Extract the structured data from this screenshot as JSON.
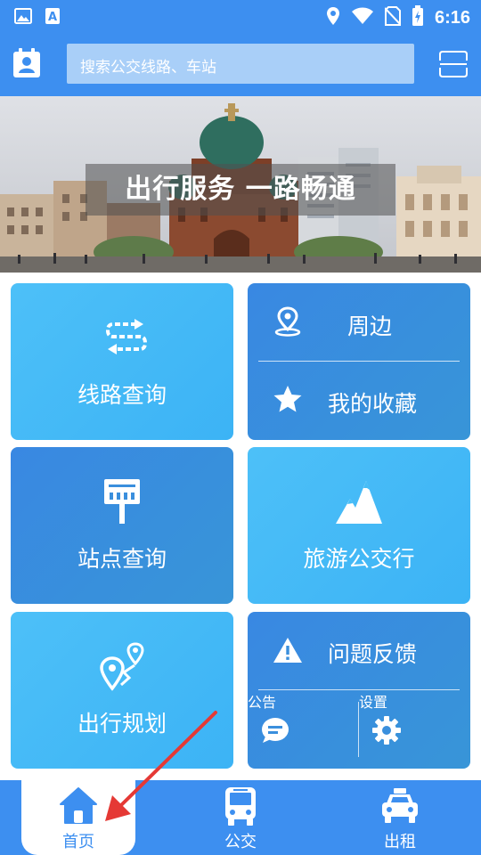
{
  "status_bar": {
    "time": "6:16",
    "icons": [
      "image-icon",
      "text-a-icon",
      "location-icon",
      "wifi-icon",
      "no-sim-icon",
      "battery-charging-icon"
    ]
  },
  "header": {
    "search_placeholder": "搜索公交线路、车站",
    "left_icon": "profile-card-icon",
    "right_icon": "scan-icon"
  },
  "banner": {
    "slogan": "出行服务 一路畅通"
  },
  "tiles": {
    "route_query": {
      "label": "线路查询",
      "icon": "route-arrows-icon"
    },
    "nearby": {
      "label": "周边",
      "icon": "location-pin-icon"
    },
    "favorites": {
      "label": "我的收藏",
      "icon": "star-icon"
    },
    "station_query": {
      "label": "站点查询",
      "icon": "bus-stop-sign-icon"
    },
    "tourism_bus": {
      "label": "旅游公交行",
      "icon": "mountain-icon"
    },
    "trip_planning": {
      "label": "出行规划",
      "icon": "map-route-icon"
    },
    "feedback": {
      "label": "问题反馈",
      "icon": "warning-icon"
    },
    "notice": {
      "label": "公告",
      "icon": "chat-bubble-icon"
    },
    "settings": {
      "label": "设置",
      "icon": "gear-icon"
    }
  },
  "bottom_nav": {
    "items": [
      {
        "label": "首页",
        "icon": "home-icon",
        "active": true
      },
      {
        "label": "公交",
        "icon": "bus-icon",
        "active": false
      },
      {
        "label": "出租",
        "icon": "taxi-icon",
        "active": false
      }
    ]
  },
  "colors": {
    "primary": "#3d8ff0",
    "tile_light": "#45bdf7",
    "tile_dark": "#3a8fdd",
    "arrow": "#e53935"
  }
}
